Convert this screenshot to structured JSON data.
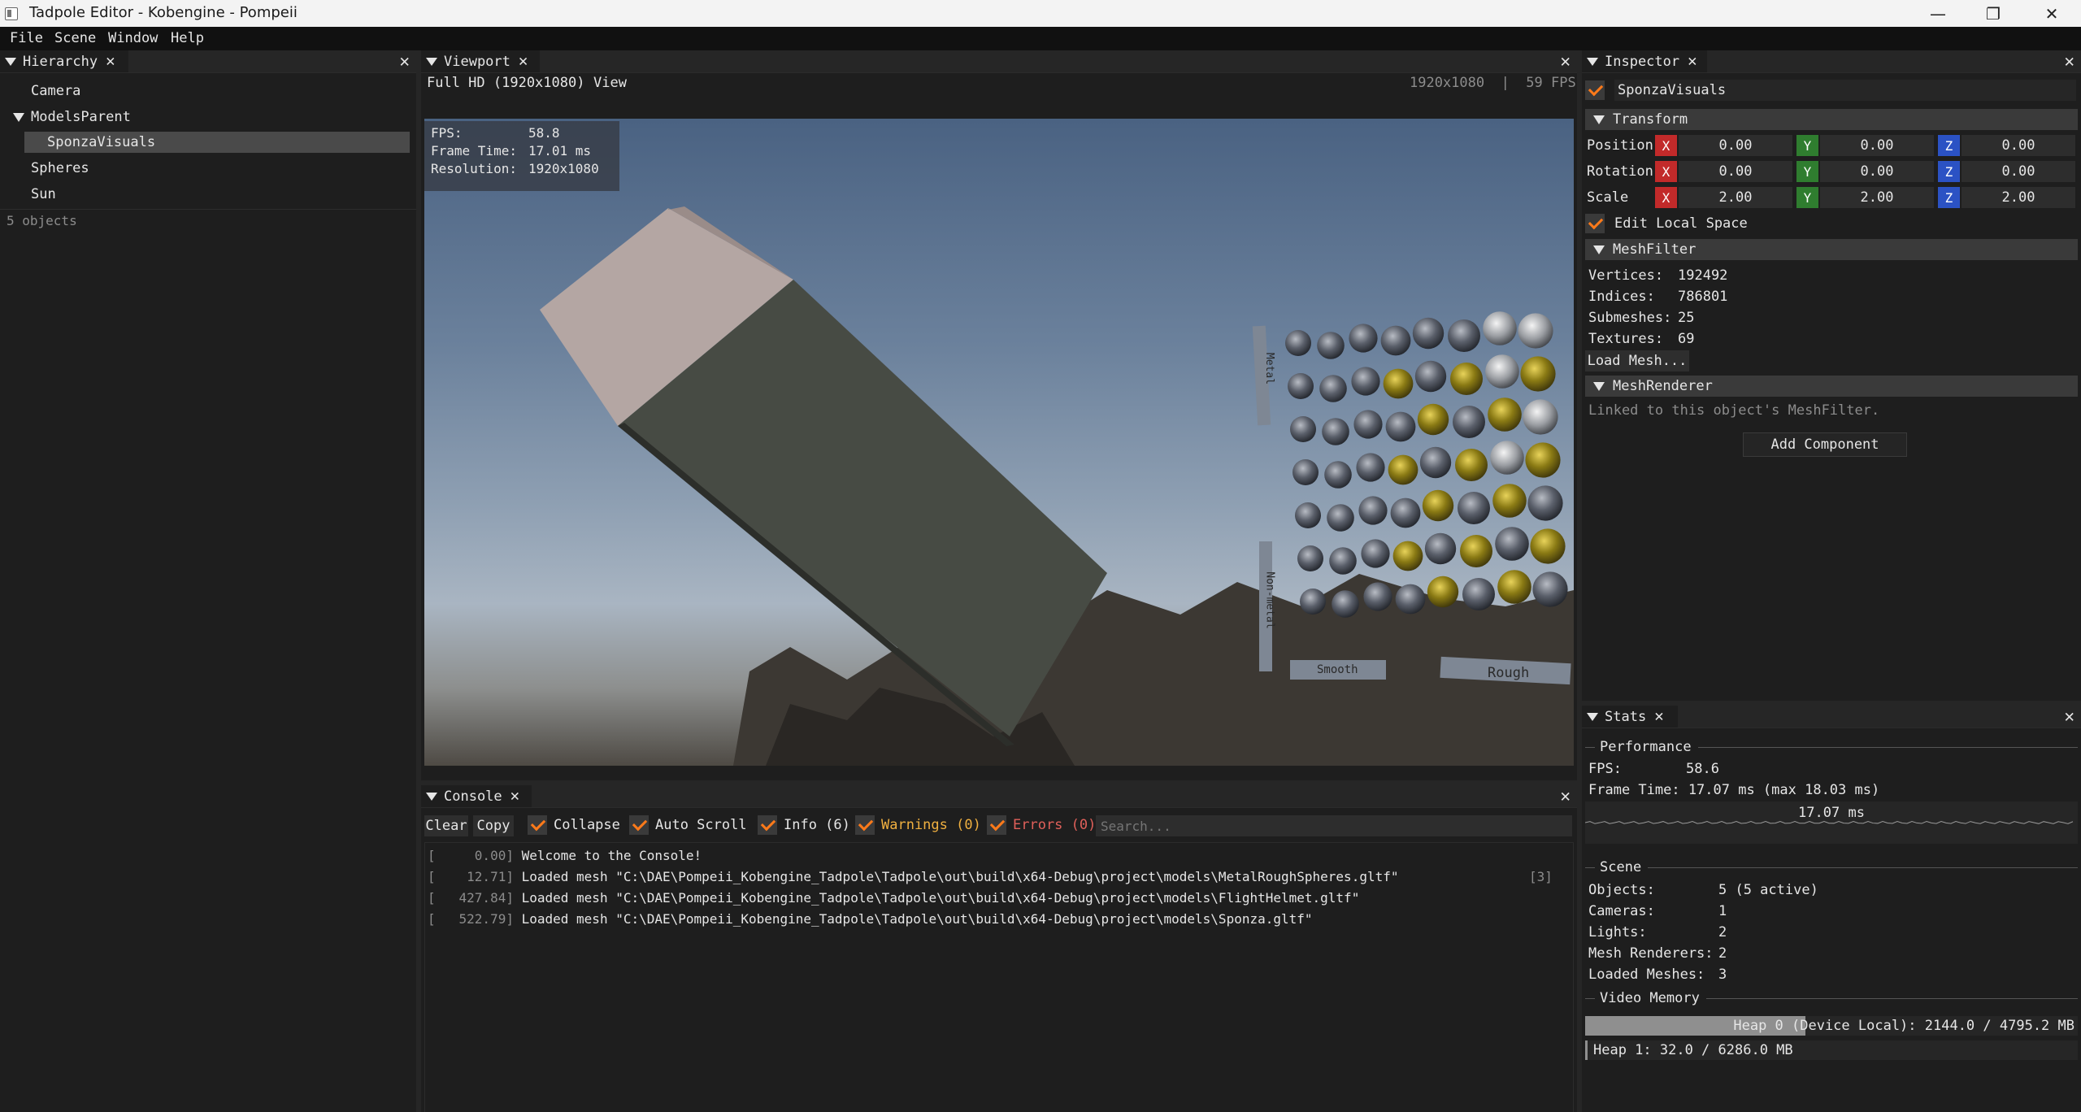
{
  "window": {
    "title": "Tadpole Editor - Kobengine - Pompeii",
    "minimize": "—",
    "restore": "❐",
    "close": "✕"
  },
  "menu": [
    "File",
    "Scene",
    "Window",
    "Help"
  ],
  "hierarchy": {
    "tab": "Hierarchy",
    "items": [
      "Camera",
      "ModelsParent",
      "SponzaVisuals",
      "Spheres",
      "Sun"
    ],
    "footer": "5 objects"
  },
  "viewport": {
    "tab": "Viewport",
    "resolution_menu": "Full HD (1920x1080)",
    "view_menu": "View",
    "status": "1920x1080  |  59 FPS",
    "overlay": {
      "fps_label": "FPS:",
      "fps": "58.8",
      "frame_label": "Frame Time:",
      "frame": "17.01 ms",
      "res_label": "Resolution:",
      "res": "1920x1080"
    },
    "scene_labels": {
      "metal": "Metal",
      "nonmetal": "Non-metal",
      "smooth": "Smooth",
      "rough": "Rough"
    }
  },
  "inspector": {
    "tab": "Inspector",
    "object_name": "SponzaVisuals",
    "transform": {
      "header": "Transform",
      "rows": [
        {
          "label": "Position",
          "x": "0.00",
          "y": "0.00",
          "z": "0.00"
        },
        {
          "label": "Rotation",
          "x": "0.00",
          "y": "0.00",
          "z": "0.00"
        },
        {
          "label": "Scale",
          "x": "2.00",
          "y": "2.00",
          "z": "2.00"
        }
      ],
      "axis_labels": [
        "X",
        "Y",
        "Z"
      ],
      "edit_local": "Edit Local Space"
    },
    "mesh_filter": {
      "header": "MeshFilter",
      "vertices_label": "Vertices:",
      "vertices": "192492",
      "indices_label": "Indices:",
      "indices": "786801",
      "submeshes_label": "Submeshes:",
      "submeshes": "25",
      "textures_label": "Textures:",
      "textures": "69",
      "load_button": "Load Mesh..."
    },
    "mesh_renderer": {
      "header": "MeshRenderer",
      "note": "Linked to this object's MeshFilter."
    },
    "add_component": "Add Component"
  },
  "stats": {
    "tab": "Stats",
    "performance": "Performance",
    "fps_label": "FPS:",
    "fps": "58.6",
    "frame_time": "Frame Time: 17.07 ms (max 18.03 ms)",
    "graph_label": "17.07 ms",
    "scene": "Scene",
    "rows": [
      {
        "label": "Objects:",
        "value": "5 (5 active)"
      },
      {
        "label": "Cameras:",
        "value": "1"
      },
      {
        "label": "Lights:",
        "value": "2"
      },
      {
        "label": "Mesh Renderers:",
        "value": "2"
      },
      {
        "label": "Loaded Meshes:",
        "value": "3"
      }
    ],
    "video_memory": "Video Memory",
    "heap0": {
      "text": "Heap 0 (Device Local): 2144.0 / 4795.2 MB",
      "fraction": 0.447
    },
    "heap1": {
      "text": "Heap 1: 32.0 / 6286.0 MB",
      "fraction": 0.005
    }
  },
  "console": {
    "tab": "Console",
    "clear": "Clear",
    "copy": "Copy",
    "collapse": "Collapse",
    "auto_scroll": "Auto Scroll",
    "info": "Info (6)",
    "warnings": "Warnings (0)",
    "errors": "Errors (0)",
    "search_placeholder": "Search...",
    "lines": [
      {
        "time": "[     0.00]",
        "msg": "Welcome to the Console!",
        "count": ""
      },
      {
        "time": "[    12.71]",
        "msg": "Loaded mesh \"C:\\DAE\\Pompeii_Kobengine_Tadpole\\Tadpole\\out\\build\\x64-Debug\\project\\models\\MetalRoughSpheres.gltf\"",
        "count": "[3]"
      },
      {
        "time": "[   427.84]",
        "msg": "Loaded mesh \"C:\\DAE\\Pompeii_Kobengine_Tadpole\\Tadpole\\out\\build\\x64-Debug\\project\\models\\FlightHelmet.gltf\"",
        "count": ""
      },
      {
        "time": "[   522.79]",
        "msg": "Loaded mesh \"C:\\DAE\\Pompeii_Kobengine_Tadpole\\Tadpole\\out\\build\\x64-Debug\\project\\models\\Sponza.gltf\"",
        "count": ""
      }
    ]
  },
  "colors": {
    "accent": "#ff7a1a",
    "warning": "#f0b040",
    "error": "#e0605a",
    "axis_x": "#c22a2a",
    "axis_y": "#2f7d2f",
    "axis_z": "#2b52c4"
  }
}
